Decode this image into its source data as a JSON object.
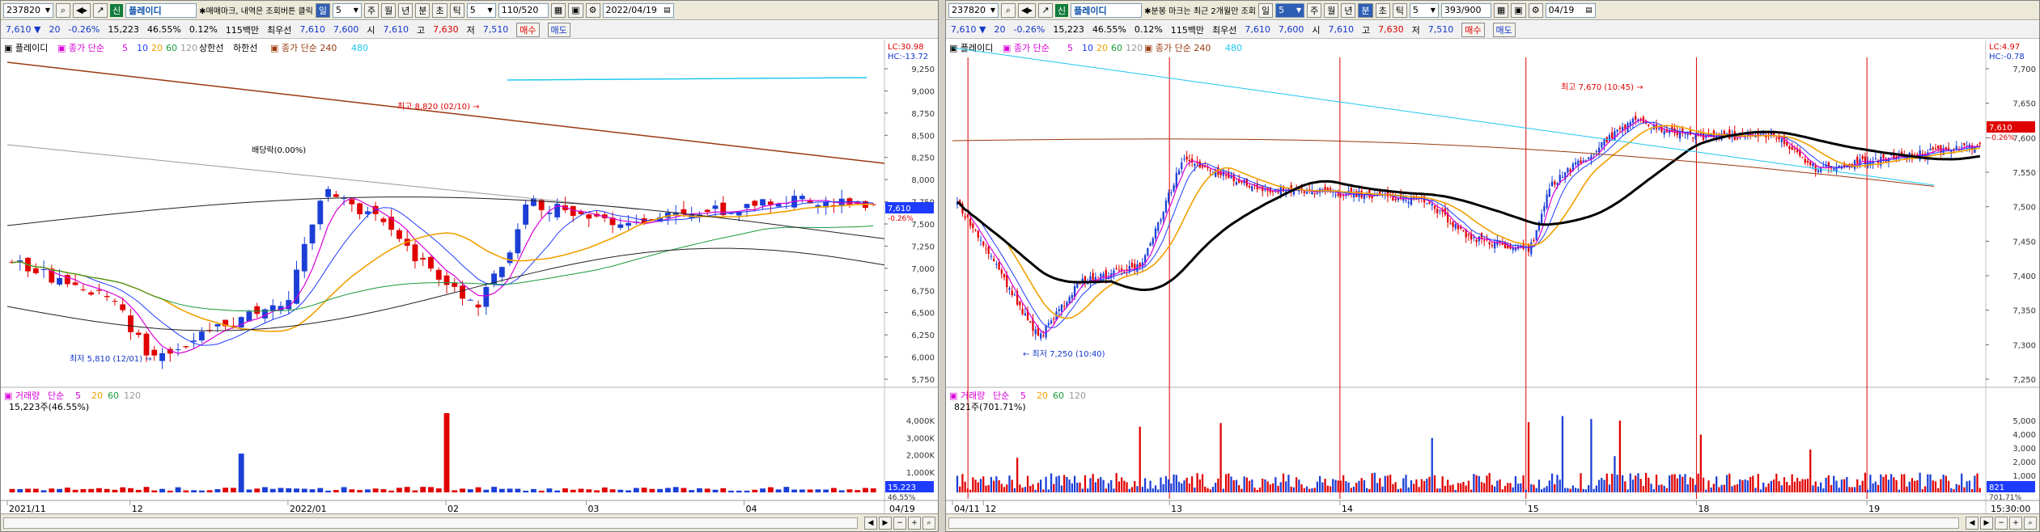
{
  "left": {
    "toolbar": {
      "code": "237820",
      "badge": "신",
      "name": "플레이디",
      "notice": "매매마크, 내역은 조회버튼 클릭",
      "periods": [
        "일",
        "5",
        "주",
        "월",
        "년",
        "분",
        "초",
        "틱"
      ],
      "interval_value": "5",
      "count": "110/520",
      "date": "2022/04/19"
    },
    "info": {
      "price": "7,610",
      "change": "20",
      "pct": "-0.26%",
      "volume": "15,223",
      "vol_pct": "46.55%",
      "turnover": "0.12%",
      "amount": "115백만",
      "label_best": "최우선",
      "ask": "7,610",
      "bid": "7,600",
      "open_label": "시",
      "open": "7,610",
      "high_label": "고",
      "high": "7,630",
      "low_label": "저",
      "low": "7,510",
      "buy": "매수",
      "sell": "매도"
    },
    "legend": {
      "name": "플레이디",
      "ma_label": "종가 단순",
      "ma": [
        "5",
        "10",
        "20",
        "60",
        "120"
      ],
      "extra1": "상한선",
      "extra2": "하한선",
      "ma240": "종가 단순 240",
      "ma480": "480",
      "lc": "LC:30.98",
      "hc": "HC:-13.72"
    },
    "price_axis": [
      "9,250",
      "9,000",
      "8,750",
      "8,500",
      "8,250",
      "8,000",
      "7,750",
      "7,500",
      "7,250",
      "7,000",
      "6,750",
      "6,500",
      "6,250",
      "6,000",
      "5,750"
    ],
    "current_price": "7,610",
    "current_pct": "-0.26%",
    "annotations": {
      "high": "최고 8,820 (02/10)",
      "low": "최저 5,810 (12/01)",
      "ex": "배당락(0.00%)"
    },
    "volume_legend": {
      "label": "거래량",
      "ma_label": "단순",
      "ma": [
        "5",
        "20",
        "60",
        "120"
      ],
      "current": "15,223주(46.55%)"
    },
    "volume_axis": [
      "4,000K",
      "3,000K",
      "2,000K",
      "1,000K"
    ],
    "volume_current": "15,223",
    "volume_pct": "46.55%",
    "date_axis": [
      "2021/11",
      "12",
      "2022/01",
      "02",
      "03",
      "04",
      "04/19"
    ]
  },
  "right": {
    "toolbar": {
      "code": "237820",
      "badge": "신",
      "name": "플레이디",
      "notice": "분봉 마크는 최근 2개월만 조회",
      "periods": [
        "일",
        "5",
        "주",
        "월",
        "년",
        "분",
        "초",
        "틱"
      ],
      "interval_value": "5",
      "count": "393/900",
      "date": "04/19"
    },
    "info": {
      "price": "7,610",
      "change": "20",
      "pct": "-0.26%",
      "volume": "15,223",
      "vol_pct": "46.55%",
      "turnover": "0.12%",
      "amount": "115백만",
      "label_best": "최우선",
      "ask": "7,610",
      "bid": "7,600",
      "open_label": "시",
      "open": "7,610",
      "high_label": "고",
      "high": "7,630",
      "low_label": "저",
      "low": "7,510",
      "buy": "매수",
      "sell": "매도"
    },
    "legend": {
      "name": "플레이디",
      "ma_label": "종가 단순",
      "ma": [
        "5",
        "10",
        "20",
        "60",
        "120"
      ],
      "ma240": "종가 단순 240",
      "ma480": "480",
      "lc": "LC:4.97",
      "hc": "HC:-0.78"
    },
    "price_axis": [
      "7,700",
      "7,650",
      "7,600",
      "7,550",
      "7,500",
      "7,450",
      "7,400",
      "7,350",
      "7,300",
      "7,250"
    ],
    "current_price": "7,610",
    "current_pct": "-0.26%",
    "annotations": {
      "high": "최고 7,670 (10:45)",
      "low": "최저 7,250 (10:40)"
    },
    "volume_legend": {
      "label": "거래량",
      "ma_label": "단순",
      "ma": [
        "5",
        "20",
        "60",
        "120"
      ],
      "current": "821주(701.71%)"
    },
    "volume_axis": [
      "5,000",
      "4,000",
      "3,000",
      "2,000",
      "1,000"
    ],
    "volume_current": "821",
    "volume_pct": "701.71%",
    "date_axis": [
      "04/11",
      "12",
      "13",
      "14",
      "15",
      "18",
      "19",
      "15:30:00"
    ]
  },
  "colors": {
    "up": "#e00000",
    "down": "#1b3fd6",
    "ma5": "#d800d8",
    "ma10": "#1e3cff",
    "ma20": "#f0a000",
    "ma60": "#1a9a3a",
    "ma120": "#9a9a9a",
    "ma240": "#9a3a10",
    "ma480": "#1fc8f0",
    "bb": "#222222"
  }
}
